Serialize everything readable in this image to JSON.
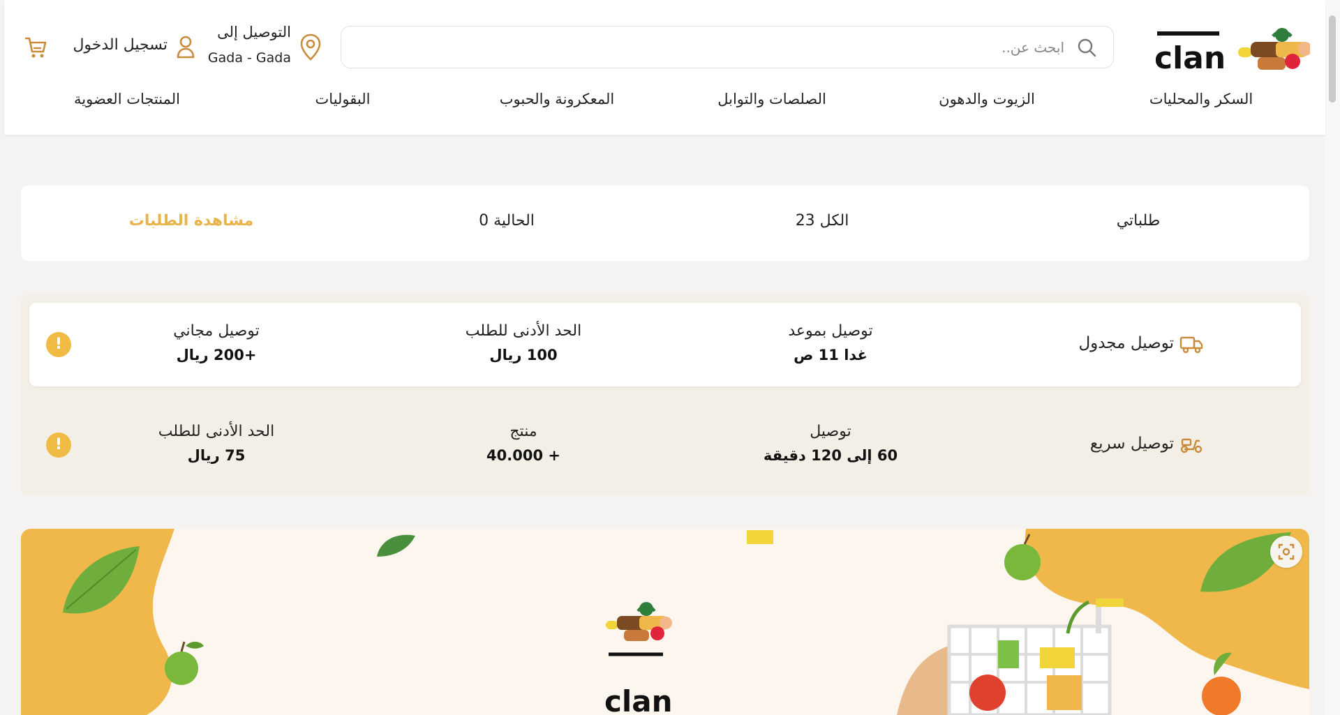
{
  "header": {
    "logo_text": "clan",
    "search": {
      "placeholder": "ابحث عن.."
    },
    "location": {
      "title": "التوصيل إلى",
      "value": "Gada - Gada"
    },
    "login_label": "تسجيل الدخول",
    "categories": [
      "السكر والمحليات",
      "الزيوت والدهون",
      "الصلصات والتوابل",
      "المعكرونة والحبوب",
      "البقوليات",
      "المنتجات العضوية"
    ]
  },
  "orders": {
    "title": "طلباتي",
    "total": "الكل 23",
    "current": "الحالية 0",
    "view_link": "مشاهدة الطلبات"
  },
  "delivery": {
    "scheduled": {
      "type": "توصيل مجدول",
      "time_label": "توصيل بموعد",
      "time_value": "غدا 11 ص",
      "min_label": "الحد الأدنى للطلب",
      "min_value": "100 ريال",
      "free_label": "توصيل مجاني",
      "free_value": "+200 ريال",
      "info_icon": "!"
    },
    "express": {
      "type": "توصيل سريع",
      "time_label": "توصيل",
      "time_value": "60 إلى 120 دقيقة",
      "products_label": "منتج",
      "products_value": "+ 40.000",
      "min_label": "الحد الأدنى للطلب",
      "min_value": "75 ريال",
      "info_icon": "!"
    }
  },
  "banner": {
    "logo_text": "clan"
  },
  "colors": {
    "accent": "#e9b34a",
    "brand_brown": "#8a5a2b",
    "info_yellow": "#f0bb44",
    "banner_orange": "#f0b84b"
  },
  "icons": [
    "search-icon",
    "location-pin-icon",
    "user-icon",
    "cart-icon",
    "truck-icon",
    "scooter-icon",
    "info-icon",
    "scan-icon"
  ]
}
